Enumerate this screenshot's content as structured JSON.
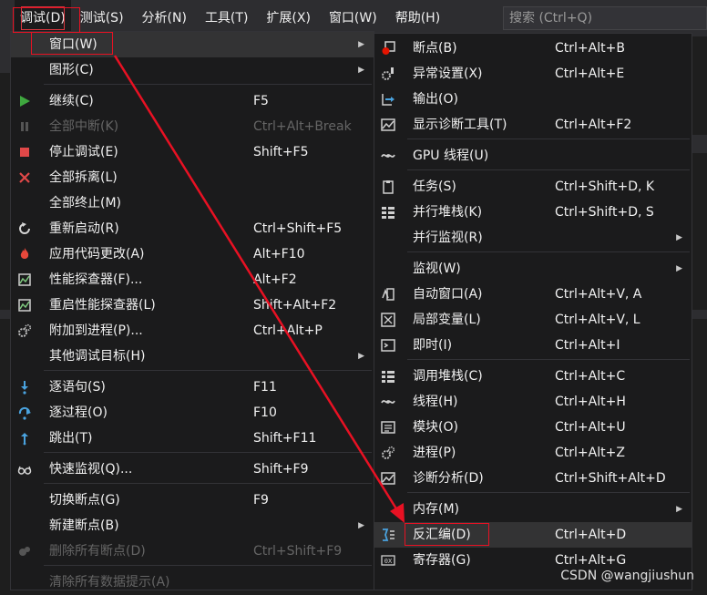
{
  "menubar": {
    "items": [
      {
        "label": "调试(D)",
        "active": true
      },
      {
        "label": "测试(S)"
      },
      {
        "label": "分析(N)"
      },
      {
        "label": "工具(T)"
      },
      {
        "label": "扩展(X)"
      },
      {
        "label": "窗口(W)"
      },
      {
        "label": "帮助(H)"
      }
    ],
    "search_placeholder": "搜索 (Ctrl+Q)"
  },
  "debug_menu": {
    "items": [
      {
        "label": "窗口(W)",
        "shortcut": "",
        "icon": "none",
        "submenu": true,
        "highlighted": true
      },
      {
        "label": "图形(C)",
        "shortcut": "",
        "icon": "none",
        "submenu": true
      },
      {
        "label": "继续(C)",
        "shortcut": "F5",
        "icon": "play-icon"
      },
      {
        "label": "全部中断(K)",
        "shortcut": "Ctrl+Alt+Break",
        "icon": "pause-icon",
        "disabled": true
      },
      {
        "label": "停止调试(E)",
        "shortcut": "Shift+F5",
        "icon": "stop-icon"
      },
      {
        "label": "全部拆离(L)",
        "shortcut": "",
        "icon": "close-icon"
      },
      {
        "label": "全部终止(M)",
        "shortcut": "",
        "icon": "none"
      },
      {
        "label": "重新启动(R)",
        "shortcut": "Ctrl+Shift+F5",
        "icon": "restart-icon"
      },
      {
        "label": "应用代码更改(A)",
        "shortcut": "Alt+F10",
        "icon": "flame-icon"
      },
      {
        "label": "性能探查器(F)...",
        "shortcut": "Alt+F2",
        "icon": "profiler-icon"
      },
      {
        "label": "重启性能探查器(L)",
        "shortcut": "Shift+Alt+F2",
        "icon": "profiler-restart-icon"
      },
      {
        "label": "附加到进程(P)...",
        "shortcut": "Ctrl+Alt+P",
        "icon": "gears-icon"
      },
      {
        "label": "其他调试目标(H)",
        "shortcut": "",
        "icon": "none",
        "submenu": true
      },
      {
        "label": "逐语句(S)",
        "shortcut": "F11",
        "icon": "step-into-icon"
      },
      {
        "label": "逐过程(O)",
        "shortcut": "F10",
        "icon": "step-over-icon"
      },
      {
        "label": "跳出(T)",
        "shortcut": "Shift+F11",
        "icon": "step-out-icon"
      },
      {
        "label": "快速监视(Q)...",
        "shortcut": "Shift+F9",
        "icon": "glasses-icon"
      },
      {
        "label": "切换断点(G)",
        "shortcut": "F9",
        "icon": "none"
      },
      {
        "label": "新建断点(B)",
        "shortcut": "",
        "icon": "none",
        "submenu": true
      },
      {
        "label": "删除所有断点(D)",
        "shortcut": "Ctrl+Shift+F9",
        "icon": "breakpoints-icon",
        "disabled": true
      },
      {
        "label": "清除所有数据提示(A)",
        "shortcut": "",
        "icon": "none",
        "disabled": true
      }
    ]
  },
  "window_submenu": {
    "items": [
      {
        "label": "断点(B)",
        "shortcut": "Ctrl+Alt+B",
        "icon": "breakpoint-window-icon"
      },
      {
        "label": "异常设置(X)",
        "shortcut": "Ctrl+Alt+E",
        "icon": "exception-settings-icon"
      },
      {
        "label": "输出(O)",
        "shortcut": "",
        "icon": "output-icon"
      },
      {
        "label": "显示诊断工具(T)",
        "shortcut": "Ctrl+Alt+F2",
        "icon": "diagnostic-tools-icon"
      },
      {
        "label": "GPU 线程(U)",
        "shortcut": "",
        "icon": "gpu-threads-icon"
      },
      {
        "label": "任务(S)",
        "shortcut": "Ctrl+Shift+D, K",
        "icon": "tasks-icon"
      },
      {
        "label": "并行堆栈(K)",
        "shortcut": "Ctrl+Shift+D, S",
        "icon": "parallel-stacks-icon"
      },
      {
        "label": "并行监视(R)",
        "shortcut": "",
        "icon": "none",
        "submenu": true
      },
      {
        "label": "监视(W)",
        "shortcut": "",
        "icon": "none",
        "submenu": true
      },
      {
        "label": "自动窗口(A)",
        "shortcut": "Ctrl+Alt+V, A",
        "icon": "autos-icon"
      },
      {
        "label": "局部变量(L)",
        "shortcut": "Ctrl+Alt+V, L",
        "icon": "locals-icon"
      },
      {
        "label": "即时(I)",
        "shortcut": "Ctrl+Alt+I",
        "icon": "immediate-icon"
      },
      {
        "label": "调用堆栈(C)",
        "shortcut": "Ctrl+Alt+C",
        "icon": "call-stack-icon"
      },
      {
        "label": "线程(H)",
        "shortcut": "Ctrl+Alt+H",
        "icon": "threads-icon"
      },
      {
        "label": "模块(O)",
        "shortcut": "Ctrl+Alt+U",
        "icon": "modules-icon"
      },
      {
        "label": "进程(P)",
        "shortcut": "Ctrl+Alt+Z",
        "icon": "processes-icon"
      },
      {
        "label": "诊断分析(D)",
        "shortcut": "Ctrl+Shift+Alt+D",
        "icon": "diagnostic-analysis-icon"
      },
      {
        "label": "内存(M)",
        "shortcut": "",
        "icon": "none",
        "submenu": true
      },
      {
        "label": "反汇编(D)",
        "shortcut": "Ctrl+Alt+D",
        "icon": "disassembly-icon",
        "highlighted": true
      },
      {
        "label": "寄存器(G)",
        "shortcut": "Ctrl+Alt+G",
        "icon": "registers-icon"
      }
    ]
  },
  "watermark": "CSDN @wangjiushun",
  "colors": {
    "menu_background": "#1b1b1c",
    "menubar_background": "#2d2d30",
    "highlight": "#333334",
    "annotation_red": "#e81123",
    "disabled_text": "#656565"
  }
}
